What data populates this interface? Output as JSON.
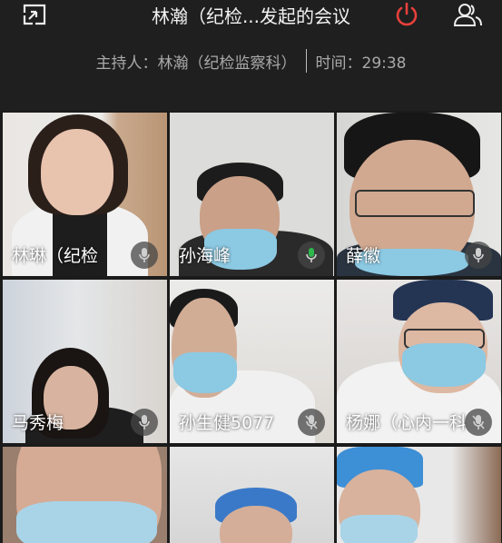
{
  "header": {
    "title": "林瀚（纪检...发起的会议",
    "host_label": "主持人：林瀚（纪检监察科）",
    "time_label": "时间：29:38"
  },
  "icons": {
    "minimize": "minimize-window-icon",
    "leave": "power-icon",
    "participants": "participants-icon",
    "mic": "microphone-icon",
    "mic_muted": "microphone-muted-icon"
  },
  "colors": {
    "background": "#1f1f1f",
    "leave_red": "#e8413c",
    "active_mic_green": "#2db84d",
    "header_text": "#f2f2f2",
    "sub_text": "#a9a9a9"
  },
  "participants": [
    {
      "name": "林琳（纪检",
      "mic": "idle"
    },
    {
      "name": "孙海峰",
      "mic": "speaking"
    },
    {
      "name": "薛徽",
      "mic": "idle"
    },
    {
      "name": "马秀梅",
      "mic": "idle"
    },
    {
      "name": "孙生健5077",
      "mic": "muted"
    },
    {
      "name": "杨娜（心内一科",
      "mic": "muted"
    },
    {
      "name": "",
      "mic": "none"
    },
    {
      "name": "",
      "mic": "none"
    },
    {
      "name": "",
      "mic": "none"
    }
  ]
}
